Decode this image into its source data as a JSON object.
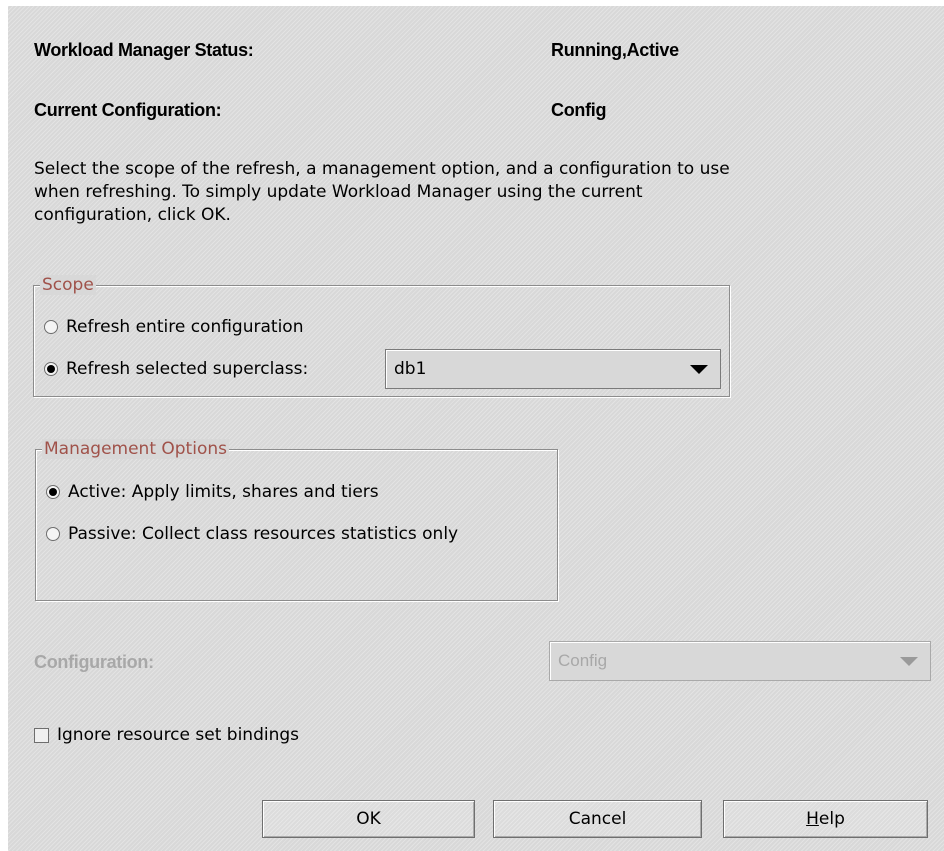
{
  "status": {
    "label": "Workload Manager Status:",
    "value": "Running,Active"
  },
  "current_config": {
    "label": "Current Configuration:",
    "value": "Config"
  },
  "description": "Select the scope of the refresh, a management option, and a configuration to use when refreshing. To simply update Workload Manager using the current configuration, click OK.",
  "scope": {
    "legend": "Scope",
    "option_entire": "Refresh entire configuration",
    "option_selected": "Refresh selected superclass:",
    "selected_option": "selected",
    "superclass_value": "db1"
  },
  "management": {
    "legend": "Management Options",
    "option_active": "Active: Apply limits, shares and tiers",
    "option_passive": "Passive: Collect class resources statistics only",
    "selected_option": "active"
  },
  "configuration": {
    "label": "Configuration:",
    "value": "Config",
    "enabled": false
  },
  "ignore_bindings": {
    "label": "Ignore resource set bindings",
    "checked": false
  },
  "buttons": {
    "ok": "OK",
    "cancel": "Cancel",
    "help_first": "H",
    "help_rest": "elp"
  }
}
